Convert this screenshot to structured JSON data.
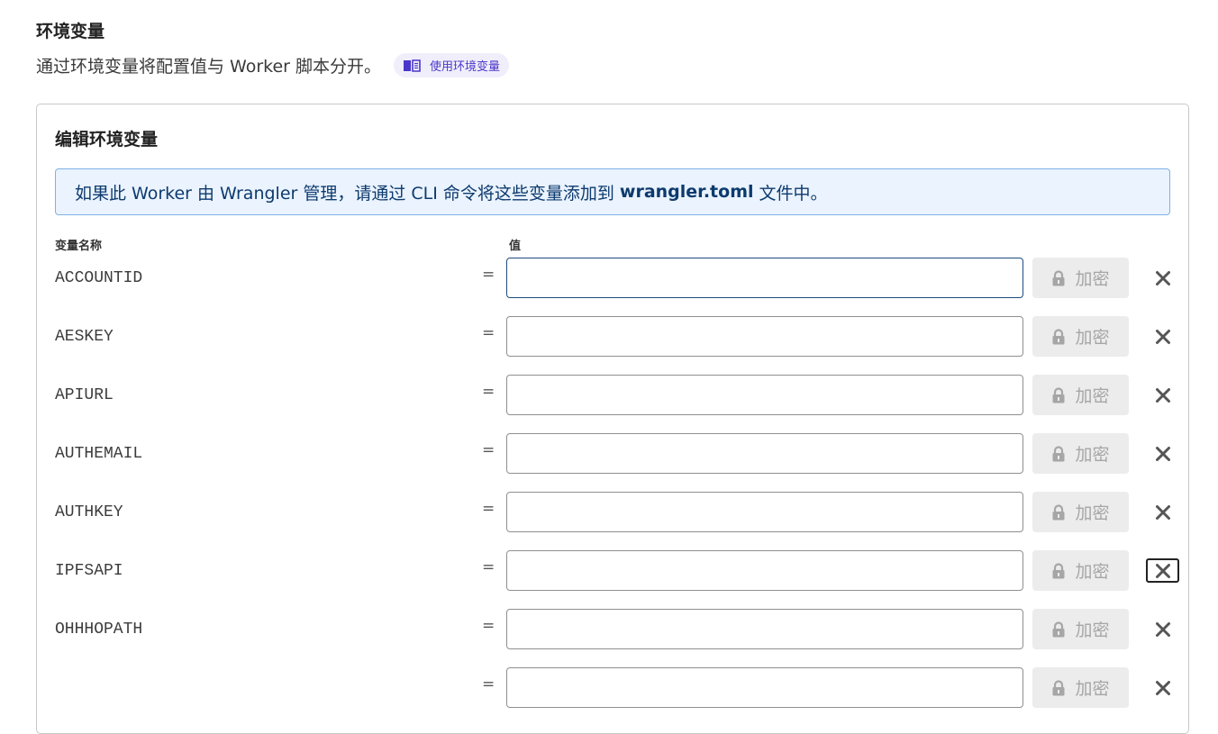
{
  "section": {
    "title": "环境变量",
    "description": "通过环境变量将配置值与 Worker 脚本分开。",
    "doc_link": "使用环境变量"
  },
  "editor": {
    "title": "编辑环境变量",
    "banner_prefix": "如果此 Worker 由 Wrangler 管理，请通过 CLI 命令将这些变量添加到",
    "banner_file": "wrangler.toml",
    "banner_suffix": "文件中。",
    "name_header": "变量名称",
    "value_header": "值",
    "equals": "=",
    "encrypt_label": "加密",
    "variables": [
      {
        "name": "ACCOUNTID",
        "value": ""
      },
      {
        "name": "AESKEY",
        "value": ""
      },
      {
        "name": "APIURL",
        "value": ""
      },
      {
        "name": "AUTHEMAIL",
        "value": ""
      },
      {
        "name": "AUTHKEY",
        "value": ""
      },
      {
        "name": "IPFSAPI",
        "value": ""
      },
      {
        "name": "OHHHOPATH",
        "value": ""
      },
      {
        "name": "",
        "value": ""
      }
    ]
  },
  "colors": {
    "accent": "#4a37c9",
    "banner_bg": "#eaf3fe",
    "banner_border": "#7fb1e6",
    "focus_border": "#1d4a7e"
  }
}
